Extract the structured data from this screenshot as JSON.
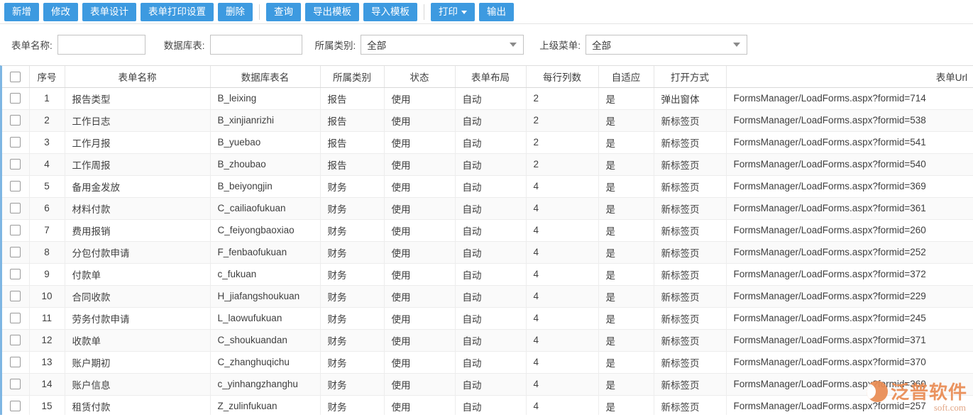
{
  "toolbar": {
    "buttons": [
      {
        "label": "新增",
        "name": "add-button"
      },
      {
        "label": "修改",
        "name": "edit-button"
      },
      {
        "label": "表单设计",
        "name": "form-design-button"
      },
      {
        "label": "表单打印设置",
        "name": "form-print-settings-button"
      },
      {
        "label": "删除",
        "name": "delete-button"
      }
    ],
    "buttons2": [
      {
        "label": "查询",
        "name": "query-button"
      },
      {
        "label": "导出模板",
        "name": "export-template-button"
      },
      {
        "label": "导入模板",
        "name": "import-template-button"
      }
    ],
    "buttons3": [
      {
        "label": "打印",
        "name": "print-button",
        "caret": true
      },
      {
        "label": "输出",
        "name": "output-button",
        "caret": false
      }
    ],
    "accent_color": "#3d9ae0"
  },
  "filters": {
    "form_name": {
      "label": "表单名称:",
      "value": "",
      "placeholder": ""
    },
    "db_table": {
      "label": "数据库表:",
      "value": "",
      "placeholder": ""
    },
    "category": {
      "label": "所属类别:",
      "value": "全部"
    },
    "parent_menu": {
      "label": "上级菜单:",
      "value": "全部"
    }
  },
  "grid": {
    "headers": {
      "index": "序号",
      "form_name": "表单名称",
      "db_table": "数据库表名",
      "category": "所属类别",
      "status": "状态",
      "layout": "表单布局",
      "cols_per_row": "每行列数",
      "adaptive": "自适应",
      "open_mode": "打开方式",
      "url": "表单Url"
    },
    "rows": [
      {
        "index": "1",
        "form_name": "报告类型",
        "db_table": "B_leixing",
        "category": "报告",
        "status": "使用",
        "layout": "自动",
        "cols_per_row": "2",
        "adaptive": "是",
        "open_mode": "弹出窗体",
        "url": "FormsManager/LoadForms.aspx?formid=714"
      },
      {
        "index": "2",
        "form_name": "工作日志",
        "db_table": "B_xinjianrizhi",
        "category": "报告",
        "status": "使用",
        "layout": "自动",
        "cols_per_row": "2",
        "adaptive": "是",
        "open_mode": "新标签页",
        "url": "FormsManager/LoadForms.aspx?formid=538"
      },
      {
        "index": "3",
        "form_name": "工作月报",
        "db_table": "B_yuebao",
        "category": "报告",
        "status": "使用",
        "layout": "自动",
        "cols_per_row": "2",
        "adaptive": "是",
        "open_mode": "新标签页",
        "url": "FormsManager/LoadForms.aspx?formid=541"
      },
      {
        "index": "4",
        "form_name": "工作周报",
        "db_table": "B_zhoubao",
        "category": "报告",
        "status": "使用",
        "layout": "自动",
        "cols_per_row": "2",
        "adaptive": "是",
        "open_mode": "新标签页",
        "url": "FormsManager/LoadForms.aspx?formid=540"
      },
      {
        "index": "5",
        "form_name": "备用金发放",
        "db_table": "B_beiyongjin",
        "category": "财务",
        "status": "使用",
        "layout": "自动",
        "cols_per_row": "4",
        "adaptive": "是",
        "open_mode": "新标签页",
        "url": "FormsManager/LoadForms.aspx?formid=369"
      },
      {
        "index": "6",
        "form_name": "材料付款",
        "db_table": "C_cailiaofukuan",
        "category": "财务",
        "status": "使用",
        "layout": "自动",
        "cols_per_row": "4",
        "adaptive": "是",
        "open_mode": "新标签页",
        "url": "FormsManager/LoadForms.aspx?formid=361"
      },
      {
        "index": "7",
        "form_name": "费用报销",
        "db_table": "C_feiyongbaoxiao",
        "category": "财务",
        "status": "使用",
        "layout": "自动",
        "cols_per_row": "4",
        "adaptive": "是",
        "open_mode": "新标签页",
        "url": "FormsManager/LoadForms.aspx?formid=260"
      },
      {
        "index": "8",
        "form_name": "分包付款申请",
        "db_table": "F_fenbaofukuan",
        "category": "财务",
        "status": "使用",
        "layout": "自动",
        "cols_per_row": "4",
        "adaptive": "是",
        "open_mode": "新标签页",
        "url": "FormsManager/LoadForms.aspx?formid=252"
      },
      {
        "index": "9",
        "form_name": "付款单",
        "db_table": "c_fukuan",
        "category": "财务",
        "status": "使用",
        "layout": "自动",
        "cols_per_row": "4",
        "adaptive": "是",
        "open_mode": "新标签页",
        "url": "FormsManager/LoadForms.aspx?formid=372"
      },
      {
        "index": "10",
        "form_name": "合同收款",
        "db_table": "H_jiafangshoukuan",
        "category": "财务",
        "status": "使用",
        "layout": "自动",
        "cols_per_row": "4",
        "adaptive": "是",
        "open_mode": "新标签页",
        "url": "FormsManager/LoadForms.aspx?formid=229"
      },
      {
        "index": "11",
        "form_name": "劳务付款申请",
        "db_table": "L_laowufukuan",
        "category": "财务",
        "status": "使用",
        "layout": "自动",
        "cols_per_row": "4",
        "adaptive": "是",
        "open_mode": "新标签页",
        "url": "FormsManager/LoadForms.aspx?formid=245"
      },
      {
        "index": "12",
        "form_name": "收款单",
        "db_table": "C_shoukuandan",
        "category": "财务",
        "status": "使用",
        "layout": "自动",
        "cols_per_row": "4",
        "adaptive": "是",
        "open_mode": "新标签页",
        "url": "FormsManager/LoadForms.aspx?formid=371"
      },
      {
        "index": "13",
        "form_name": "账户期初",
        "db_table": "C_zhanghuqichu",
        "category": "财务",
        "status": "使用",
        "layout": "自动",
        "cols_per_row": "4",
        "adaptive": "是",
        "open_mode": "新标签页",
        "url": "FormsManager/LoadForms.aspx?formid=370"
      },
      {
        "index": "14",
        "form_name": "账户信息",
        "db_table": "c_yinhangzhanghu",
        "category": "财务",
        "status": "使用",
        "layout": "自动",
        "cols_per_row": "4",
        "adaptive": "是",
        "open_mode": "新标签页",
        "url": "FormsManager/LoadForms.aspx?formid=360"
      },
      {
        "index": "15",
        "form_name": "租赁付款",
        "db_table": "Z_zulinfukuan",
        "category": "财务",
        "status": "使用",
        "layout": "自动",
        "cols_per_row": "4",
        "adaptive": "是",
        "open_mode": "新标签页",
        "url": "FormsManager/LoadForms.aspx?formid=257"
      }
    ]
  },
  "watermark": {
    "text": "泛普软件",
    "sub": "soft.com",
    "color": "#e98b52"
  }
}
